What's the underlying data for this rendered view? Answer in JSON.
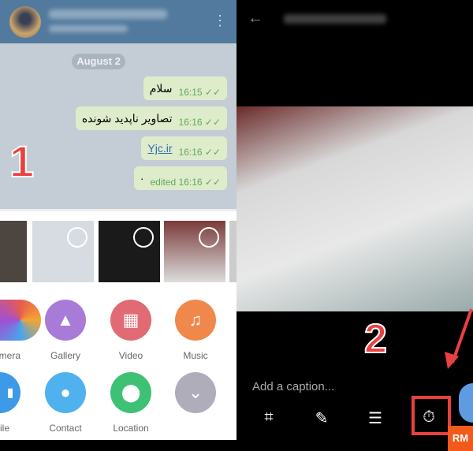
{
  "chat": {
    "date": "August 2",
    "messages": [
      {
        "text": "سلام",
        "time": "16:15",
        "ticks": "✓✓"
      },
      {
        "text": "تصاویر ناپدید شونده",
        "time": "16:16",
        "ticks": "✓✓"
      },
      {
        "text": "Yjc.ir",
        "time": "16:16",
        "ticks": "✓✓"
      },
      {
        "text": "·",
        "time": "edited 16:16",
        "ticks": "✓✓"
      }
    ],
    "step_label": "1"
  },
  "attach": {
    "items": [
      {
        "label": "Camera",
        "color": "#e75c4f"
      },
      {
        "label": "Gallery",
        "color": "#a87bd8"
      },
      {
        "label": "Video",
        "color": "#e06b74"
      },
      {
        "label": "Music",
        "color": "#f0884b"
      },
      {
        "label": "File",
        "color": "#3d9ae8"
      },
      {
        "label": "Contact",
        "color": "#4fb2ee"
      },
      {
        "label": "Location",
        "color": "#3ec174"
      },
      {
        "label": "",
        "color": "#b0adba"
      }
    ]
  },
  "editor": {
    "step_label": "2",
    "caption_placeholder": "Add a caption...",
    "watermark": "RM",
    "accent": "#e94040"
  }
}
